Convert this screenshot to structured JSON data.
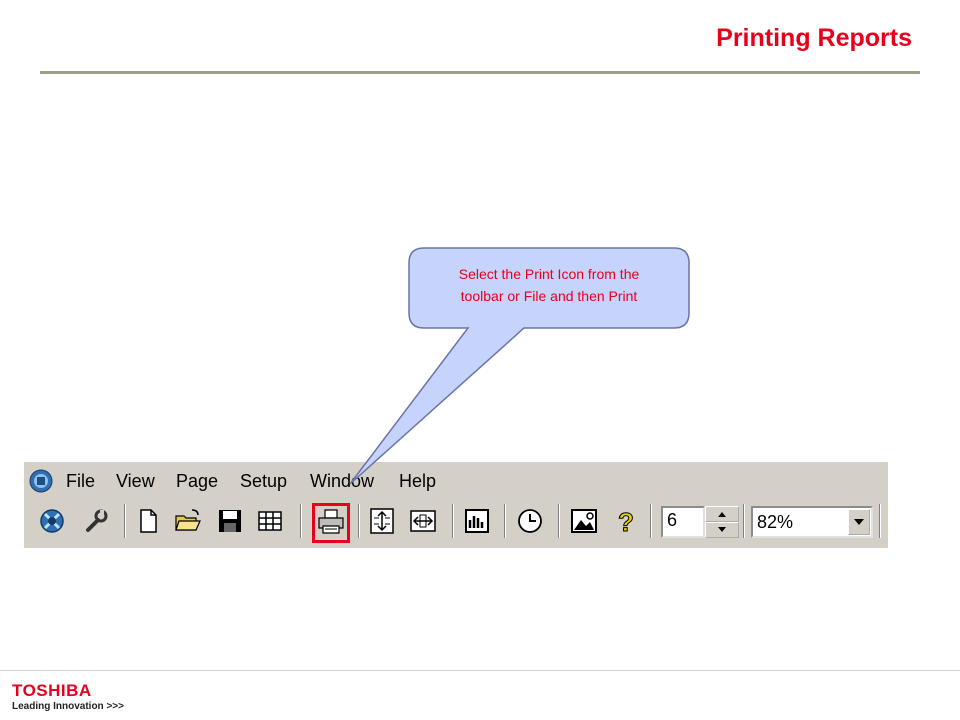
{
  "slide": {
    "title": "Printing Reports",
    "callout": {
      "line1": "Select the Print Icon from the",
      "line2": "toolbar or File and then Print"
    }
  },
  "app": {
    "menu": [
      "File",
      "View",
      "Page",
      "Setup",
      "Window",
      "Help"
    ],
    "toolbar": {
      "buttons": [
        "connect-icon",
        "wrench-icon",
        "new-document-icon",
        "open-folder-icon",
        "save-icon",
        "grid-icon",
        "print-icon",
        "fit-height-icon",
        "fit-width-icon",
        "report-icon",
        "clock-icon",
        "image-icon",
        "help-icon"
      ],
      "highlighted": "print-icon",
      "page_spinner_value": "6",
      "zoom_value": "82%"
    }
  },
  "footer": {
    "logo": "TOSHIBA",
    "tagline": "Leading Innovation >>>"
  },
  "colors": {
    "accent": "#e8001c",
    "callout_fill": "#c6d3fb",
    "callout_stroke": "#6a74a8",
    "toolbar_bg": "#d4d0c8"
  }
}
